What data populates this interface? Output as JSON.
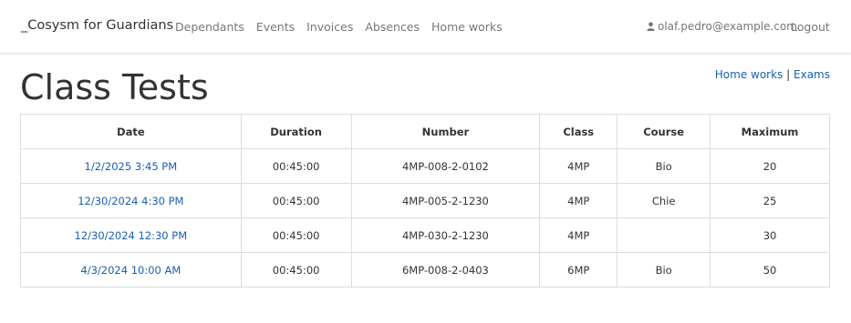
{
  "navbar": {
    "brand": "_Cosysm for Guardians",
    "links": [
      "Dependants",
      "Events",
      "Invoices",
      "Absences",
      "Home works"
    ],
    "user_email": "olaf.pedro@example.com",
    "logout": "Logout"
  },
  "page": {
    "title": "Class Tests",
    "links": {
      "home_works": "Home works",
      "separator": "|",
      "exams": "Exams"
    }
  },
  "table": {
    "headers": [
      "Date",
      "Duration",
      "Number",
      "Class",
      "Course",
      "Maximum"
    ],
    "rows": [
      [
        "1/2/2025 3:45 PM",
        "00:45:00",
        "4MP-008-2-0102",
        "4MP",
        "Bio",
        "20"
      ],
      [
        "12/30/2024 4:30 PM",
        "00:45:00",
        "4MP-005-2-1230",
        "4MP",
        "Chie",
        "25"
      ],
      [
        "12/30/2024 12:30 PM",
        "00:45:00",
        "4MP-030-2-1230",
        "4MP",
        "",
        "30"
      ],
      [
        "4/3/2024 10:00 AM",
        "00:45:00",
        "6MP-008-2-0403",
        "6MP",
        "Bio",
        "50"
      ]
    ]
  },
  "colors": {
    "link": "#1a5fb4",
    "nav_text": "#777777",
    "border": "#dddddd"
  }
}
